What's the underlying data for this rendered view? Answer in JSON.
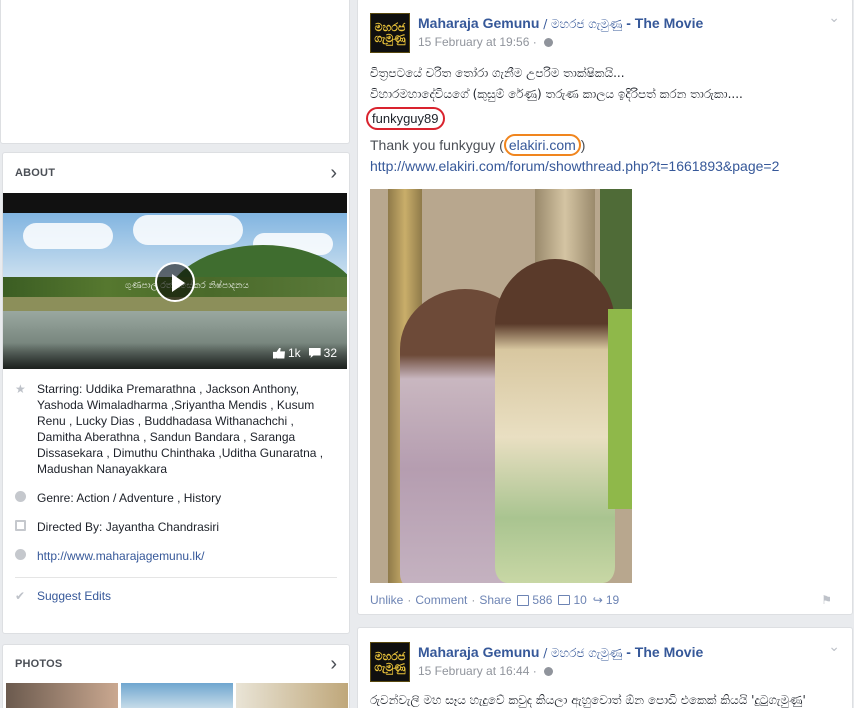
{
  "about": {
    "title": "ABOUT",
    "video": {
      "caption": "ගුණපාල  රත්නසේකර  නිෂ්පාදනය",
      "likes": "1k",
      "comments": "32"
    },
    "starring": "Starring: Uddika Premarathna , Jackson Anthony, Yashoda Wimaladharma ,Sriyantha Mendis , Kusum Renu , Lucky Dias , Buddhadasa Withanachchi , Damitha Aberathna , Sandun Bandara , Saranga Dissasekara , Dimuthu Chinthaka ,Uditha Gunaratna , Madushan Nanayakkara",
    "genre": "Genre: Action / Adventure , History",
    "directed": "Directed By: Jayantha Chandrasiri",
    "website": "http://www.maharajagemunu.lk/",
    "suggest_edits": "Suggest Edits"
  },
  "photos": {
    "title": "PHOTOS"
  },
  "post1": {
    "page_name": "Maharaja Gemunu",
    "page_name_sep": " / මහරජ ගැමුණු",
    "page_name_suffix": " - The Movie",
    "logo_line1": "මහරජ",
    "logo_line2": "ගැමුණු",
    "time": "15 February at 19:56",
    "line1": "චිත්‍රපටයේ චරිත තෝරා ගැනීම උපරිම තාක්ෂිකයි...",
    "line2": "විහාරමහාදේවියගේ (කුසුම් රේණු) තරුණ කාලය ඉදිරිපත් කරන තාරුකා....",
    "username": "funkyguy89",
    "thanks_prefix": "Thank you funkyguy (",
    "thanks_link": "elakiri.com",
    "thanks_suffix": ")",
    "url": "http://www.elakiri.com/forum/showthread.php?t=1661893&page=2",
    "actions": {
      "unlike": "Unlike",
      "comment": "Comment",
      "share": "Share"
    },
    "stats": {
      "likes": "586",
      "comments": "10",
      "shares": "19"
    }
  },
  "post2": {
    "page_name": "Maharaja Gemunu",
    "page_name_sep": " / මහරජ ගැමුණු",
    "page_name_suffix": " - The Movie",
    "time": "15 February at 16:44",
    "line1": "රුවන්වැලි මහ සෑය හැදුවේ කවුද කියලා ඇහුවොත් ඕන පොඩි එකෙක් කියයි 'දුටුගැමුණු'"
  }
}
